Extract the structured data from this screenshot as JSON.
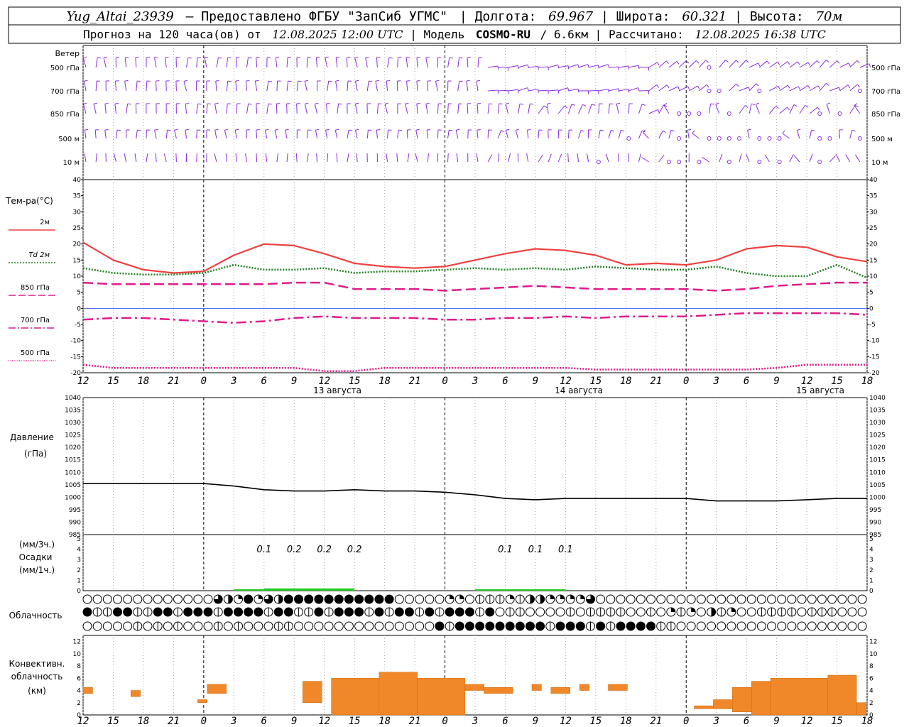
{
  "header": {
    "station": "Yug_Altai_23939",
    "provider": "– Предоставлено ФГБУ \"ЗапСиб УГМС\"",
    "lon_label": "Долгота:",
    "lon": "69.967",
    "lat_label": "Широта:",
    "lat": "60.321",
    "alt_label": "Высота:",
    "alt": "70м",
    "forecast_prefix": "Прогноз на 120 часа(ов) от",
    "forecast_time": "12.08.2025 12:00 UTC",
    "model_label": "Модель",
    "model": "COSMO-RU",
    "resolution": "/ 6.6км",
    "computed_label": "Рассчитано:",
    "computed_time": "12.08.2025 16:38 UTC"
  },
  "time_axis": {
    "hour_labels": [
      "12",
      "15",
      "18",
      "21",
      "0",
      "3",
      "6",
      "9",
      "12",
      "15",
      "18",
      "21",
      "0",
      "3",
      "6",
      "9",
      "12",
      "15",
      "18",
      "21",
      "0",
      "3",
      "6",
      "9",
      "12",
      "15",
      "18"
    ],
    "day_labels": [
      "13 августа",
      "14 августа",
      "15 августа"
    ]
  },
  "wind_panel": {
    "title": "Ветер",
    "levels": [
      "500 гПа",
      "700 гПа",
      "850 гПа",
      "500 м",
      "10 м"
    ],
    "colors": {
      "barb": "#8a2be2"
    }
  },
  "temperature_panel": {
    "title": "Тем-ра(°C)",
    "yticks": [
      "40",
      "35",
      "30",
      "25",
      "20",
      "15",
      "10",
      "5",
      "0",
      "-5",
      "-10",
      "-15",
      "-20"
    ],
    "legend": [
      {
        "label": "2м",
        "color": "#f04040",
        "dash": "solid"
      },
      {
        "label": "Td  2м",
        "color": "#208020",
        "dash": "dot"
      },
      {
        "label": "850 гПа",
        "color": "#e01a8c",
        "dash": "dash"
      },
      {
        "label": "700 гПа",
        "color": "#e01a8c",
        "dash": "dashdot"
      },
      {
        "label": "500 гПа",
        "color": "#e01a8c",
        "dash": "fine"
      }
    ]
  },
  "pressure_panel": {
    "title": "Давление",
    "unit": "(гПа)",
    "yticks": [
      "1040",
      "1035",
      "1030",
      "1025",
      "1020",
      "1015",
      "1010",
      "1005",
      "1000",
      "995",
      "990",
      "985"
    ]
  },
  "precip_panel": {
    "label_top": "(мм/3ч.)",
    "label_mid": "Осадки",
    "label_bot": "(мм/1ч.)",
    "yticks": [
      "5",
      "4",
      "3",
      "2",
      "1",
      "0"
    ],
    "amounts": [
      {
        "text": "0.1",
        "hour": 18
      },
      {
        "text": "0.2",
        "hour": 21
      },
      {
        "text": "0.2",
        "hour": 24
      },
      {
        "text": "0.2",
        "hour": 27
      },
      {
        "text": "0.1",
        "hour": 42
      },
      {
        "text": "0.1",
        "hour": 45
      },
      {
        "text": "0.1",
        "hour": 48
      }
    ]
  },
  "cloud_panel": {
    "title": "Облачность"
  },
  "conv_panel": {
    "label1": "Конвективн.",
    "label2": "облачность",
    "label3": "(км)",
    "yticks": [
      "12",
      "10",
      "8",
      "6",
      "4",
      "2",
      "0"
    ]
  },
  "chart_data": [
    {
      "type": "line",
      "title": "Тем-ра(°C)",
      "x_hours_from_start": [
        0,
        3,
        6,
        9,
        12,
        15,
        18,
        21,
        24,
        27,
        30,
        33,
        36,
        39,
        42,
        45,
        48,
        51,
        54,
        57,
        60,
        63,
        66,
        69,
        72,
        75,
        78
      ],
      "ylim": [
        -20,
        40
      ],
      "series": [
        {
          "name": "2м",
          "values": [
            20.5,
            15,
            12,
            11,
            11.5,
            16.5,
            20,
            19.5,
            17,
            14,
            13,
            12.5,
            13,
            15,
            17,
            18.5,
            18,
            16.5,
            13.5,
            14,
            13.5,
            15,
            18.5,
            19.5,
            19,
            16,
            14.5
          ]
        },
        {
          "name": "Td  2м",
          "values": [
            12.5,
            11,
            10.5,
            10.5,
            11,
            13.5,
            12,
            12,
            12.5,
            11,
            11.5,
            11.5,
            12,
            12.5,
            12,
            12.5,
            12,
            13,
            12.5,
            12,
            12,
            13,
            11,
            10,
            10,
            13.5,
            9.5
          ]
        },
        {
          "name": "850 гПа",
          "values": [
            8,
            7.5,
            7.5,
            7.5,
            7.5,
            7.5,
            7.5,
            8,
            8,
            6,
            6,
            6,
            5.5,
            6,
            6.5,
            7,
            6.5,
            6,
            6,
            6,
            6,
            5.5,
            6,
            7,
            7.5,
            8,
            8
          ]
        },
        {
          "name": "700 гПа",
          "values": [
            -3.5,
            -3,
            -3,
            -3.5,
            -4,
            -4.5,
            -4,
            -3,
            -2.5,
            -3,
            -3,
            -3,
            -3.5,
            -3.5,
            -3,
            -3,
            -2.5,
            -3,
            -2.5,
            -2.5,
            -2.5,
            -2,
            -1.5,
            -1.5,
            -1.5,
            -1.5,
            -2
          ]
        },
        {
          "name": "500 гПа",
          "values": [
            -17.5,
            -18.5,
            -18.5,
            -18.5,
            -18.5,
            -18.5,
            -18.5,
            -18.5,
            -19.5,
            -19.5,
            -18.5,
            -18.5,
            -18.5,
            -18.5,
            -18.5,
            -18.5,
            -18.5,
            -19,
            -19,
            -19,
            -19,
            -19,
            -19,
            -18.5,
            -17.5,
            -17.5,
            -17.5
          ]
        }
      ]
    },
    {
      "type": "line",
      "title": "Давление",
      "x_hours_from_start": [
        0,
        3,
        6,
        9,
        12,
        15,
        18,
        21,
        24,
        27,
        30,
        33,
        36,
        39,
        42,
        45,
        48,
        51,
        54,
        57,
        60,
        63,
        66,
        69,
        72,
        75,
        78
      ],
      "ylim": [
        985,
        1040
      ],
      "series": [
        {
          "name": "Давление",
          "values": [
            1005.5,
            1005.5,
            1005.5,
            1005.5,
            1005.5,
            1004.5,
            1003,
            1002.5,
            1002.5,
            1003,
            1002.5,
            1002.5,
            1002,
            1001,
            999.5,
            999,
            999.5,
            999.5,
            999.5,
            999.5,
            999.5,
            998.5,
            998.5,
            998.5,
            999,
            999.5,
            999.5
          ]
        }
      ]
    },
    {
      "type": "bar",
      "title": "Осадки",
      "x_hours_from_start": [
        18,
        21,
        24,
        27,
        42,
        45,
        48
      ],
      "ylim": [
        0,
        5
      ],
      "series": [
        {
          "name": "Осадки",
          "values": [
            0.1,
            0.2,
            0.2,
            0.2,
            0.1,
            0.1,
            0.1
          ]
        }
      ]
    },
    {
      "type": "bar",
      "title": "Конвективн. облачность (км)",
      "ylim": [
        0,
        13
      ],
      "segments": [
        {
          "x0": 0,
          "x1": 1,
          "bottom": 3.5,
          "top": 4.5
        },
        {
          "x0": 5,
          "x1": 6,
          "bottom": 3,
          "top": 4
        },
        {
          "x0": 12,
          "x1": 13,
          "bottom": 2,
          "top": 2.5
        },
        {
          "x0": 13,
          "x1": 15,
          "bottom": 3.5,
          "top": 5
        },
        {
          "x0": 23,
          "x1": 25,
          "bottom": 2,
          "top": 5.5
        },
        {
          "x0": 26,
          "x1": 31,
          "bottom": 0,
          "top": 6
        },
        {
          "x0": 31,
          "x1": 35,
          "bottom": 0,
          "top": 7
        },
        {
          "x0": 35,
          "x1": 40,
          "bottom": 0,
          "top": 6
        },
        {
          "x0": 40,
          "x1": 42,
          "bottom": 4,
          "top": 5
        },
        {
          "x0": 42,
          "x1": 45,
          "bottom": 3.5,
          "top": 4.5
        },
        {
          "x0": 47,
          "x1": 48,
          "bottom": 4,
          "top": 5
        },
        {
          "x0": 49,
          "x1": 51,
          "bottom": 3.5,
          "top": 4.5
        },
        {
          "x0": 52,
          "x1": 53,
          "bottom": 4,
          "top": 5
        },
        {
          "x0": 55,
          "x1": 57,
          "bottom": 4,
          "top": 5
        },
        {
          "x0": 64,
          "x1": 66,
          "bottom": 1,
          "top": 1.5
        },
        {
          "x0": 66,
          "x1": 68,
          "bottom": 1,
          "top": 2.5
        },
        {
          "x0": 68,
          "x1": 70,
          "bottom": 0.5,
          "top": 4.5
        },
        {
          "x0": 70,
          "x1": 72,
          "bottom": 0,
          "top": 5.5
        },
        {
          "x0": 72,
          "x1": 78,
          "bottom": 0,
          "top": 6
        },
        {
          "x0": 78,
          "x1": 81,
          "bottom": 0,
          "top": 6.5
        },
        {
          "x0": 81,
          "x1": 82,
          "bottom": 0,
          "top": 2
        }
      ]
    }
  ]
}
